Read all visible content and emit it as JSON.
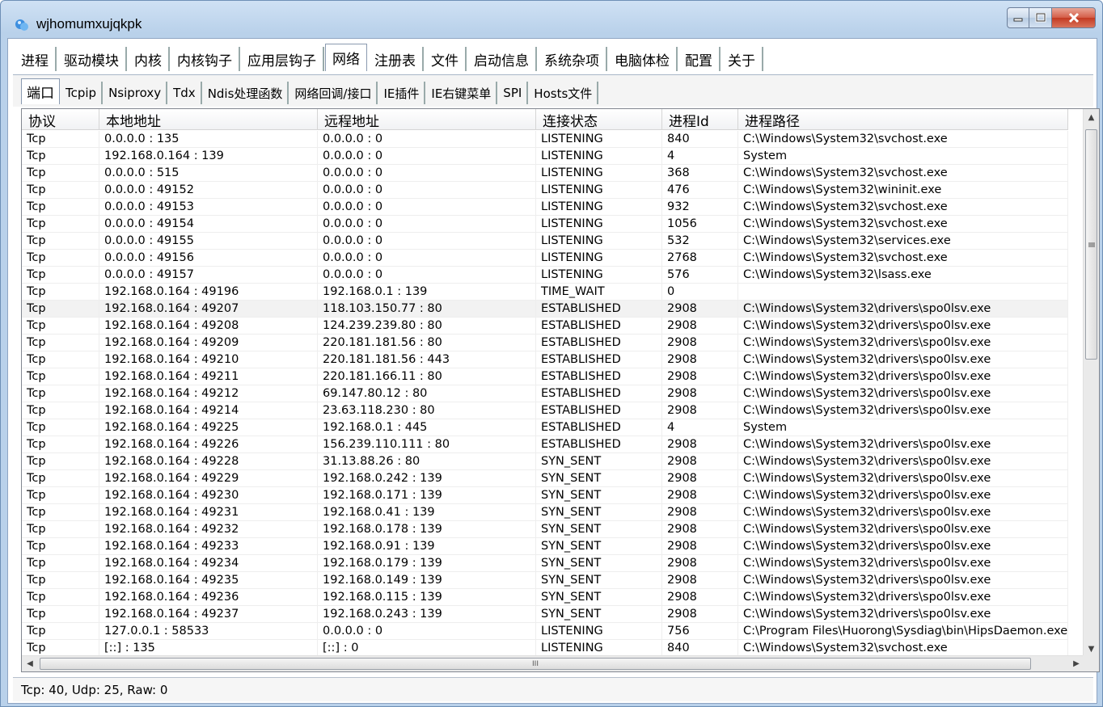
{
  "window": {
    "title": "wjhomumxujqkpk"
  },
  "main_tabs": [
    "进程",
    "驱动模块",
    "内核",
    "内核钩子",
    "应用层钩子",
    "网络",
    "注册表",
    "文件",
    "启动信息",
    "系统杂项",
    "电脑体检",
    "配置",
    "关于"
  ],
  "sub_tabs": [
    "端口",
    "Tcpip",
    "Nsiproxy",
    "Tdx",
    "Ndis处理函数",
    "网络回调/接口",
    "IE插件",
    "IE右键菜单",
    "SPI",
    "Hosts文件"
  ],
  "columns": [
    "协议",
    "本地地址",
    "远程地址",
    "连接状态",
    "进程Id",
    "进程路径"
  ],
  "rows": [
    [
      "Tcp",
      "0.0.0.0 : 135",
      "0.0.0.0 : 0",
      "LISTENING",
      "840",
      "C:\\Windows\\System32\\svchost.exe"
    ],
    [
      "Tcp",
      "192.168.0.164 : 139",
      "0.0.0.0 : 0",
      "LISTENING",
      "4",
      "System"
    ],
    [
      "Tcp",
      "0.0.0.0 : 515",
      "0.0.0.0 : 0",
      "LISTENING",
      "368",
      "C:\\Windows\\System32\\svchost.exe"
    ],
    [
      "Tcp",
      "0.0.0.0 : 49152",
      "0.0.0.0 : 0",
      "LISTENING",
      "476",
      "C:\\Windows\\System32\\wininit.exe"
    ],
    [
      "Tcp",
      "0.0.0.0 : 49153",
      "0.0.0.0 : 0",
      "LISTENING",
      "932",
      "C:\\Windows\\System32\\svchost.exe"
    ],
    [
      "Tcp",
      "0.0.0.0 : 49154",
      "0.0.0.0 : 0",
      "LISTENING",
      "1056",
      "C:\\Windows\\System32\\svchost.exe"
    ],
    [
      "Tcp",
      "0.0.0.0 : 49155",
      "0.0.0.0 : 0",
      "LISTENING",
      "532",
      "C:\\Windows\\System32\\services.exe"
    ],
    [
      "Tcp",
      "0.0.0.0 : 49156",
      "0.0.0.0 : 0",
      "LISTENING",
      "2768",
      "C:\\Windows\\System32\\svchost.exe"
    ],
    [
      "Tcp",
      "0.0.0.0 : 49157",
      "0.0.0.0 : 0",
      "LISTENING",
      "576",
      "C:\\Windows\\System32\\lsass.exe"
    ],
    [
      "Tcp",
      "192.168.0.164 : 49196",
      "192.168.0.1 : 139",
      "TIME_WAIT",
      "0",
      ""
    ],
    [
      "Tcp",
      "192.168.0.164 : 49207",
      "118.103.150.77 : 80",
      "ESTABLISHED",
      "2908",
      "C:\\Windows\\System32\\drivers\\spo0lsv.exe"
    ],
    [
      "Tcp",
      "192.168.0.164 : 49208",
      "124.239.239.80 : 80",
      "ESTABLISHED",
      "2908",
      "C:\\Windows\\System32\\drivers\\spo0lsv.exe"
    ],
    [
      "Tcp",
      "192.168.0.164 : 49209",
      "220.181.181.56 : 80",
      "ESTABLISHED",
      "2908",
      "C:\\Windows\\System32\\drivers\\spo0lsv.exe"
    ],
    [
      "Tcp",
      "192.168.0.164 : 49210",
      "220.181.181.56 : 443",
      "ESTABLISHED",
      "2908",
      "C:\\Windows\\System32\\drivers\\spo0lsv.exe"
    ],
    [
      "Tcp",
      "192.168.0.164 : 49211",
      "220.181.166.11 : 80",
      "ESTABLISHED",
      "2908",
      "C:\\Windows\\System32\\drivers\\spo0lsv.exe"
    ],
    [
      "Tcp",
      "192.168.0.164 : 49212",
      "69.147.80.12 : 80",
      "ESTABLISHED",
      "2908",
      "C:\\Windows\\System32\\drivers\\spo0lsv.exe"
    ],
    [
      "Tcp",
      "192.168.0.164 : 49214",
      "23.63.118.230 : 80",
      "ESTABLISHED",
      "2908",
      "C:\\Windows\\System32\\drivers\\spo0lsv.exe"
    ],
    [
      "Tcp",
      "192.168.0.164 : 49225",
      "192.168.0.1 : 445",
      "ESTABLISHED",
      "4",
      "System"
    ],
    [
      "Tcp",
      "192.168.0.164 : 49226",
      "156.239.110.111 : 80",
      "ESTABLISHED",
      "2908",
      "C:\\Windows\\System32\\drivers\\spo0lsv.exe"
    ],
    [
      "Tcp",
      "192.168.0.164 : 49228",
      "31.13.88.26 : 80",
      "SYN_SENT",
      "2908",
      "C:\\Windows\\System32\\drivers\\spo0lsv.exe"
    ],
    [
      "Tcp",
      "192.168.0.164 : 49229",
      "192.168.0.242 : 139",
      "SYN_SENT",
      "2908",
      "C:\\Windows\\System32\\drivers\\spo0lsv.exe"
    ],
    [
      "Tcp",
      "192.168.0.164 : 49230",
      "192.168.0.171 : 139",
      "SYN_SENT",
      "2908",
      "C:\\Windows\\System32\\drivers\\spo0lsv.exe"
    ],
    [
      "Tcp",
      "192.168.0.164 : 49231",
      "192.168.0.41 : 139",
      "SYN_SENT",
      "2908",
      "C:\\Windows\\System32\\drivers\\spo0lsv.exe"
    ],
    [
      "Tcp",
      "192.168.0.164 : 49232",
      "192.168.0.178 : 139",
      "SYN_SENT",
      "2908",
      "C:\\Windows\\System32\\drivers\\spo0lsv.exe"
    ],
    [
      "Tcp",
      "192.168.0.164 : 49233",
      "192.168.0.91 : 139",
      "SYN_SENT",
      "2908",
      "C:\\Windows\\System32\\drivers\\spo0lsv.exe"
    ],
    [
      "Tcp",
      "192.168.0.164 : 49234",
      "192.168.0.179 : 139",
      "SYN_SENT",
      "2908",
      "C:\\Windows\\System32\\drivers\\spo0lsv.exe"
    ],
    [
      "Tcp",
      "192.168.0.164 : 49235",
      "192.168.0.149 : 139",
      "SYN_SENT",
      "2908",
      "C:\\Windows\\System32\\drivers\\spo0lsv.exe"
    ],
    [
      "Tcp",
      "192.168.0.164 : 49236",
      "192.168.0.115 : 139",
      "SYN_SENT",
      "2908",
      "C:\\Windows\\System32\\drivers\\spo0lsv.exe"
    ],
    [
      "Tcp",
      "192.168.0.164 : 49237",
      "192.168.0.243 : 139",
      "SYN_SENT",
      "2908",
      "C:\\Windows\\System32\\drivers\\spo0lsv.exe"
    ],
    [
      "Tcp",
      "127.0.0.1 : 58533",
      "0.0.0.0 : 0",
      "LISTENING",
      "756",
      "C:\\Program Files\\Huorong\\Sysdiag\\bin\\HipsDaemon.exe"
    ],
    [
      "Tcp",
      "[::] : 135",
      "[::] : 0",
      "LISTENING",
      "840",
      "C:\\Windows\\System32\\svchost.exe"
    ]
  ],
  "selected_row": 10,
  "status": {
    "text": "Tcp: 40, Udp: 25, Raw: 0"
  },
  "hscroll_grip": "III",
  "colors": {
    "title_gradient": "#b9d1ea",
    "close_button": "#c33a22",
    "selected_row": "#f2f2f2"
  },
  "icons": {
    "app": "app-blue-droplet-icon",
    "minimize": "minimize-icon",
    "maximize": "maximize-icon",
    "close": "close-icon"
  }
}
